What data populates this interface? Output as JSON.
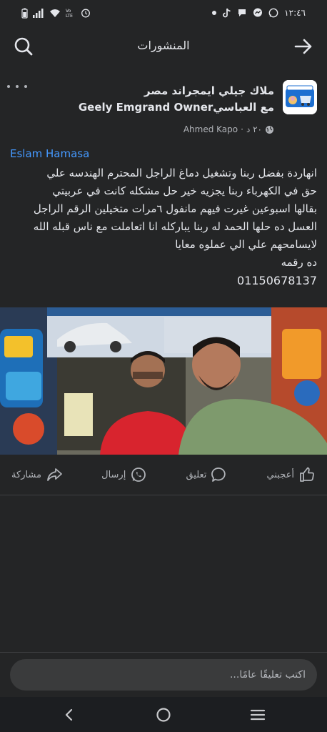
{
  "status_bar": {
    "time": "١٢:٤٦",
    "icons": [
      "battery-icon",
      "signal-icon",
      "wifi-icon",
      "volte-icon",
      "alarm-icon",
      "dot-icon",
      "tiktok-icon",
      "chat-bubble-icon",
      "messenger-icon",
      "whatsapp-icon"
    ]
  },
  "app_bar": {
    "title": "المنشورات",
    "search_icon": "search-icon",
    "forward_icon": "arrow-right-icon"
  },
  "post": {
    "title_line1": "ملاك جيلي ايمجراند مصر",
    "title_line2": "مع العباسيGeely Emgrand Owner",
    "author": "Ahmed Kapo",
    "time": "٢٠ د",
    "privacy_icon": "globe-icon",
    "commenter_name": "Eslam Hamasa",
    "body_lines": [
      "انهاردة بفضل ربنا وتشغيل دماغ الراجل المحترم الهندسه علي",
      "حق في الكهرباء ربنا يجزيه خير حل مشكله كانت في عربيتي",
      "بقالها اسبوعين غيرت فيهم مانفول ٦مرات متخيلين الرقم الراجل",
      "العسل ده حلها الحمد له ربنا يباركله انا اتعاملت مع ناس قبله الله",
      "لايسامحهم علي الي عملوه معايا",
      "ده رقمه",
      "01150678137"
    ]
  },
  "actions": {
    "like": "أعجبني",
    "comment": "تعليق",
    "send": "إرسال",
    "share": "مشاركة"
  },
  "comment_box": {
    "placeholder": "اكتب تعليقًا عامًا..."
  },
  "colors": {
    "background": "#242526",
    "text": "#e4e6eb",
    "secondary_text": "#b0b3b8",
    "link": "#4599ff"
  }
}
